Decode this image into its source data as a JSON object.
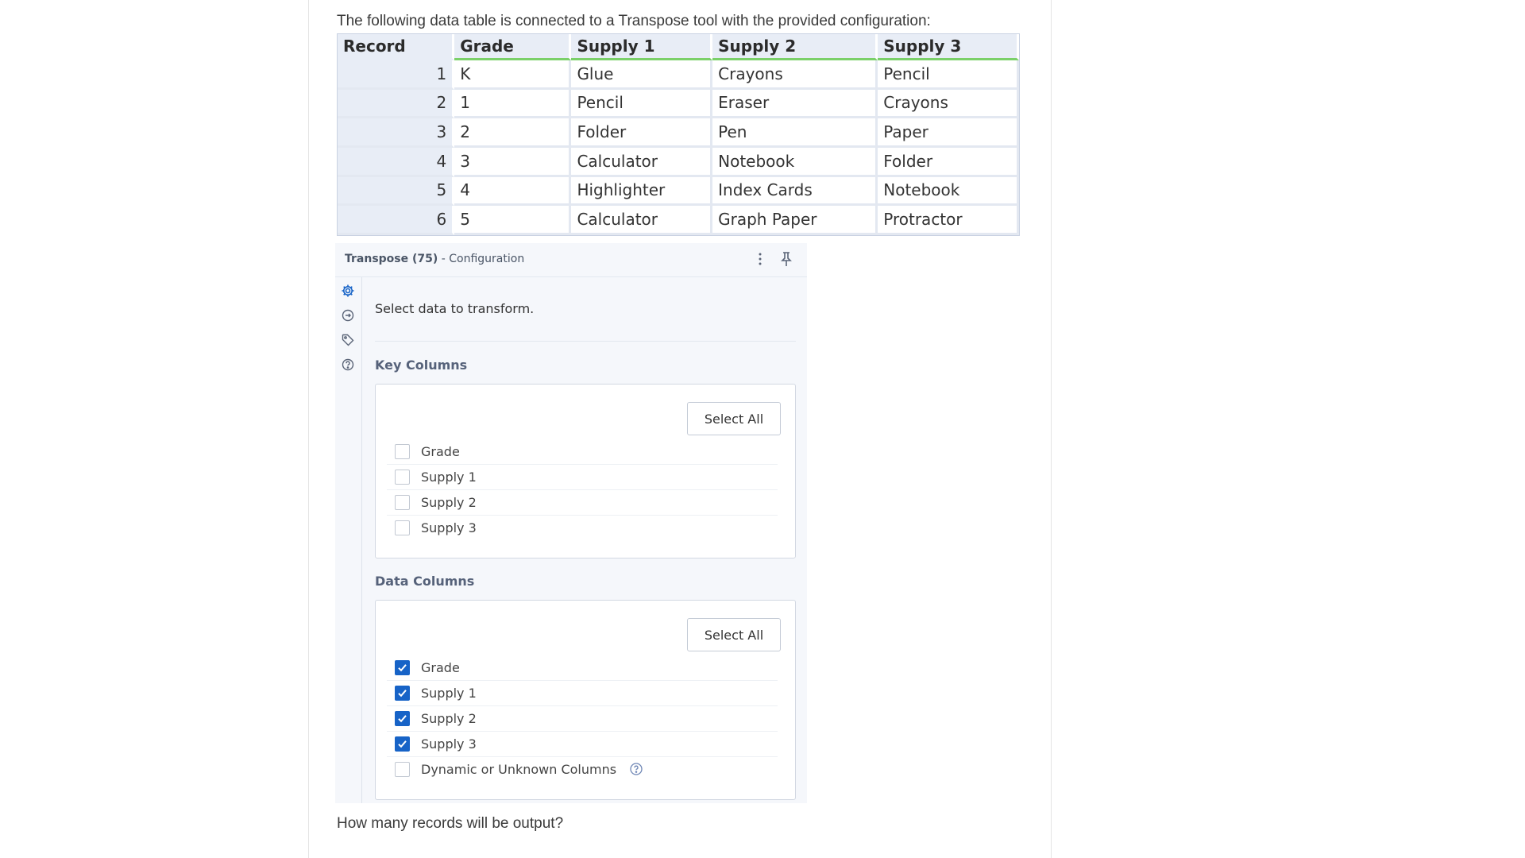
{
  "intro_text": "The following data table is connected to a Transpose tool with the provided configuration:",
  "table": {
    "headers": [
      "Record",
      "Grade",
      "Supply 1",
      "Supply 2",
      "Supply 3"
    ],
    "rows": [
      [
        "1",
        "K",
        "Glue",
        "Crayons",
        "Pencil"
      ],
      [
        "2",
        "1",
        "Pencil",
        "Eraser",
        "Crayons"
      ],
      [
        "3",
        "2",
        "Folder",
        "Pen",
        "Paper"
      ],
      [
        "4",
        "3",
        "Calculator",
        "Notebook",
        "Folder"
      ],
      [
        "5",
        "4",
        "Highlighter",
        "Index Cards",
        "Notebook"
      ],
      [
        "6",
        "5",
        "Calculator",
        "Graph Paper",
        "Protractor"
      ]
    ]
  },
  "panel": {
    "title_bold": "Transpose (75)",
    "title_rest": " - Configuration",
    "helper_text": "Select data to transform.",
    "key_columns": {
      "label": "Key Columns",
      "select_all": "Select All",
      "options": [
        {
          "label": "Grade",
          "checked": false
        },
        {
          "label": "Supply 1",
          "checked": false
        },
        {
          "label": "Supply 2",
          "checked": false
        },
        {
          "label": "Supply 3",
          "checked": false
        }
      ]
    },
    "data_columns": {
      "label": "Data Columns",
      "select_all": "Select All",
      "options": [
        {
          "label": "Grade",
          "checked": true
        },
        {
          "label": "Supply 1",
          "checked": true
        },
        {
          "label": "Supply 2",
          "checked": true
        },
        {
          "label": "Supply 3",
          "checked": true
        },
        {
          "label": "Dynamic or Unknown Columns",
          "checked": false
        }
      ]
    },
    "icons": [
      "kebab-menu-icon",
      "pin-icon",
      "gear-icon",
      "connection-icon",
      "tag-icon",
      "help-icon"
    ],
    "accent_color": "#1763c7"
  },
  "question_text": "How many records will be output?"
}
